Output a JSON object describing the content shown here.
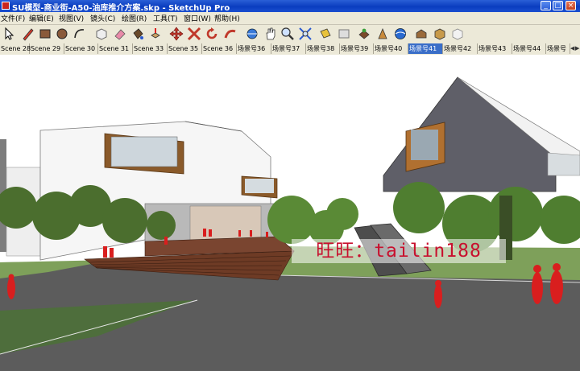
{
  "window": {
    "title": "SU模型-商业街-A50-油库推介方案.skp - SketchUp Pro",
    "minimize": "_",
    "maximize": "□",
    "close": "×"
  },
  "menu": [
    "文件(F)",
    "编辑(E)",
    "视图(V)",
    "镜头(C)",
    "绘图(R)",
    "工具(T)",
    "窗口(W)",
    "帮助(H)"
  ],
  "toolbar": {
    "tools": [
      "select-tool",
      "pencil-tool",
      "rectangle-tool",
      "circle-tool",
      "arc-tool",
      "make-component-tool",
      "eraser-tool",
      "paint-bucket-tool",
      "push-pull-tool",
      "move-tool",
      "rotate-tool",
      "follow-me-tool",
      "orbit-tool",
      "pan-tool",
      "zoom-tool",
      "zoom-extents-tool",
      "section-plane-tool",
      "previous-view-tool",
      "get-models-tool",
      "share-model-tool",
      "photo-textures-tool",
      "extension-warehouse-tool",
      "components-tool",
      "styles-tool"
    ]
  },
  "scenes": {
    "tabs": [
      "Scene 28",
      "Scene 29",
      "Scene 30",
      "Scene 31",
      "Scene 33",
      "Scene 35",
      "Scene 36",
      "场景号36",
      "场景号37",
      "场景号38",
      "场景号39",
      "场景号40",
      "场景号41",
      "场景号42",
      "场景号43",
      "场景号44",
      "场景号"
    ],
    "active": "场景号41",
    "scroll_left": "◀",
    "scroll_right": "▶"
  },
  "viewport": {
    "watermark": "旺旺：tailin188",
    "colors": {
      "sky": "#ffffff",
      "grass": "#4d6e3a",
      "pavement": "#636363",
      "steps": "#6e3b25",
      "figures": "#d91e1e"
    }
  }
}
